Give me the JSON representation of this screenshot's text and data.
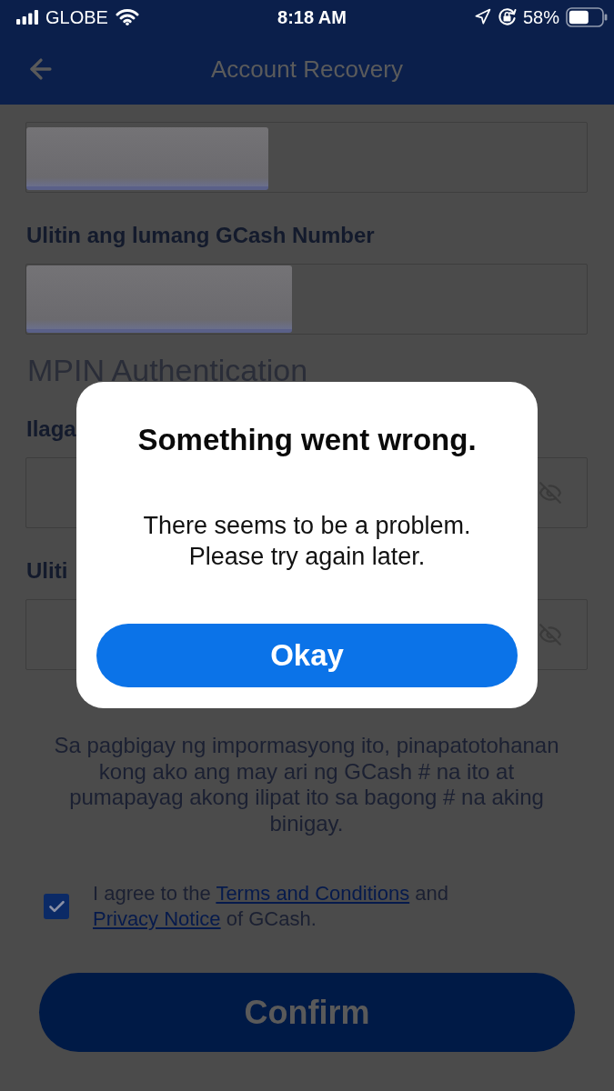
{
  "status_bar": {
    "carrier": "GLOBE",
    "time": "8:18 AM",
    "battery": "58%"
  },
  "nav": {
    "title": "Account Recovery"
  },
  "fields": [
    {
      "kind": "text",
      "redacted": true
    },
    {
      "kind": "text",
      "label": "Ulitin ang lumang GCash Number",
      "redacted": true
    }
  ],
  "mpin": {
    "heading": "MPIN Authentication",
    "fields": [
      {
        "kind": "password",
        "label": "Ilaga"
      },
      {
        "kind": "password",
        "label": "Uliti"
      }
    ]
  },
  "consent": {
    "lines": [
      "Sa pagbigay ng impormasyong ito, pinapatotohanan",
      "kong ako ang may ari ng GCash # na ito at",
      "pumapayag akong ilipat ito sa bagong # na aking",
      "binigay."
    ]
  },
  "agreement": {
    "checked": true,
    "parts": [
      {
        "kind": "text",
        "text": "I agree to the "
      },
      {
        "kind": "link",
        "text": "Terms and Conditions"
      },
      {
        "kind": "text",
        "text": " and "
      },
      {
        "kind": "link",
        "text": "Privacy Notice"
      },
      {
        "kind": "text",
        "text": " of GCash."
      }
    ]
  },
  "confirm": {
    "label": "Confirm"
  },
  "dialog": {
    "title": "Something went wrong.",
    "message_lines": [
      "There seems to be a problem.",
      "Please try again later."
    ],
    "button": "Okay"
  }
}
